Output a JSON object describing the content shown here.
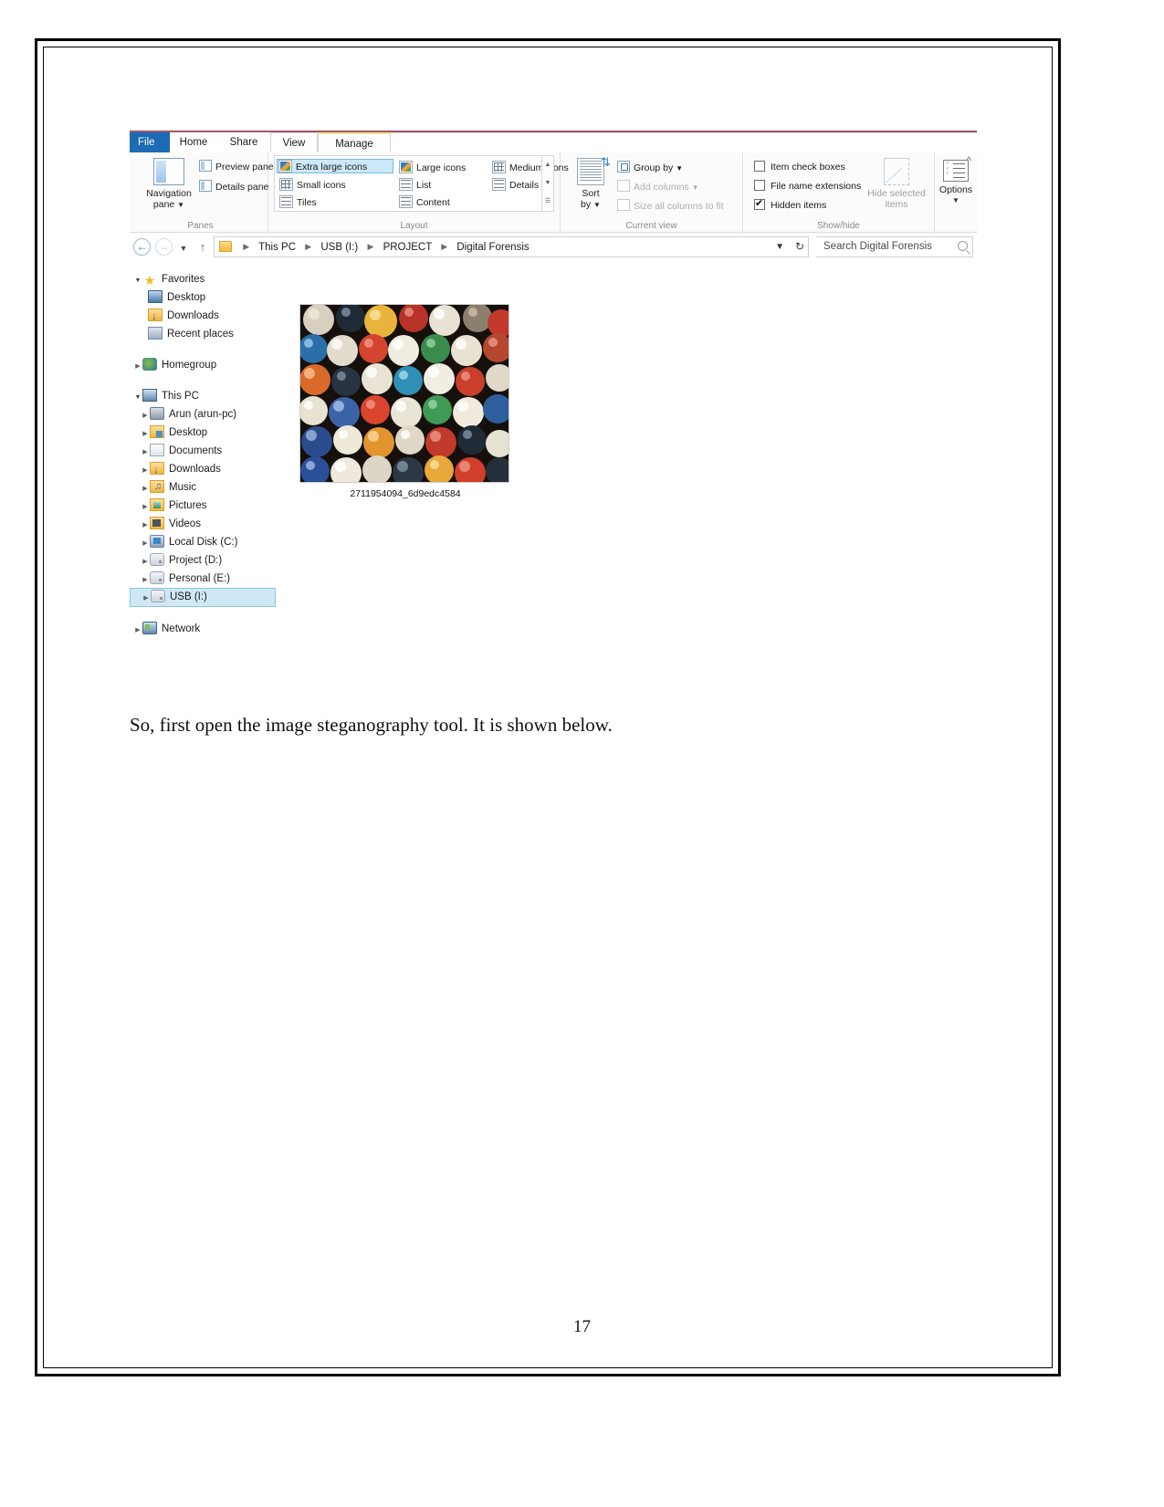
{
  "document": {
    "paragraph": "So, first open the image steganography tool. It is shown below.",
    "page_number": "17"
  },
  "explorer": {
    "tabs": [
      {
        "id": "file",
        "label": "File"
      },
      {
        "id": "home",
        "label": "Home"
      },
      {
        "id": "share",
        "label": "Share"
      },
      {
        "id": "view",
        "label": "View"
      },
      {
        "id": "manage",
        "label": "Manage"
      }
    ],
    "ribbon": {
      "collapse_icon": "chevron-up-icon",
      "groups": {
        "panes": {
          "label": "Panes",
          "navigation_pane": "Navigation\npane",
          "navigation_pane_line1": "Navigation",
          "navigation_pane_line2": "pane",
          "preview_pane": "Preview pane",
          "details_pane": "Details pane"
        },
        "layout": {
          "label": "Layout",
          "items": [
            "Extra large icons",
            "Large icons",
            "Medium icons",
            "Small icons",
            "List",
            "Details",
            "Tiles",
            "Content"
          ],
          "selected": "Extra large icons"
        },
        "current_view": {
          "label": "Current view",
          "sort_by_line1": "Sort",
          "sort_by_line2": "by",
          "group_by": "Group by",
          "add_columns": "Add columns",
          "size_all_columns": "Size all columns to fit"
        },
        "show_hide": {
          "label": "Show/hide",
          "item_check_boxes": {
            "label": "Item check boxes",
            "checked": false
          },
          "file_name_extensions": {
            "label": "File name extensions",
            "checked": false
          },
          "hidden_items": {
            "label": "Hidden items",
            "checked": true
          },
          "hide_selected_line1": "Hide selected",
          "hide_selected_line2": "items"
        },
        "options": {
          "label": "Options"
        }
      }
    },
    "address_bar": {
      "back_icon": "back-arrow-icon",
      "forward_icon": "forward-arrow-icon",
      "recent_icon": "chevron-down-icon",
      "up_icon": "up-arrow-icon",
      "breadcrumbs": [
        "This PC",
        "USB (I:)",
        "PROJECT",
        "Digital Forensis"
      ],
      "dropdown_icon": "chevron-down-icon",
      "refresh_icon": "refresh-icon",
      "search_placeholder": "Search Digital Forensis",
      "search_value": "Search Digital Forensis"
    },
    "nav_tree": [
      {
        "label": "Favorites",
        "level": 0,
        "twisty": "open",
        "icon": "star-icon"
      },
      {
        "label": "Desktop",
        "level": 1,
        "twisty": "none",
        "icon": "monitor-icon"
      },
      {
        "label": "Downloads",
        "level": 1,
        "twisty": "none",
        "icon": "downloads-folder-icon"
      },
      {
        "label": "Recent places",
        "level": 1,
        "twisty": "none",
        "icon": "recent-places-icon"
      },
      {
        "label": "Homegroup",
        "level": 0,
        "twisty": "closed",
        "icon": "homegroup-icon"
      },
      {
        "label": "This PC",
        "level": 0,
        "twisty": "open",
        "icon": "this-pc-icon"
      },
      {
        "label": "Arun (arun-pc)",
        "level": 1,
        "twisty": "closed",
        "icon": "user-icon"
      },
      {
        "label": "Desktop",
        "level": 1,
        "twisty": "closed",
        "icon": "desktop-folder-icon"
      },
      {
        "label": "Documents",
        "level": 1,
        "twisty": "closed",
        "icon": "documents-folder-icon"
      },
      {
        "label": "Downloads",
        "level": 1,
        "twisty": "closed",
        "icon": "downloads-folder-icon"
      },
      {
        "label": "Music",
        "level": 1,
        "twisty": "closed",
        "icon": "music-folder-icon"
      },
      {
        "label": "Pictures",
        "level": 1,
        "twisty": "closed",
        "icon": "pictures-folder-icon"
      },
      {
        "label": "Videos",
        "level": 1,
        "twisty": "closed",
        "icon": "videos-folder-icon"
      },
      {
        "label": "Local Disk (C:)",
        "level": 1,
        "twisty": "closed",
        "icon": "local-disk-icon"
      },
      {
        "label": "Project (D:)",
        "level": 1,
        "twisty": "closed",
        "icon": "drive-icon"
      },
      {
        "label": "Personal (E:)",
        "level": 1,
        "twisty": "closed",
        "icon": "drive-icon"
      },
      {
        "label": "USB (I:)",
        "level": 1,
        "twisty": "closed",
        "icon": "drive-icon",
        "selected": true
      },
      {
        "label": "Network",
        "level": 0,
        "twisty": "closed",
        "icon": "network-icon"
      }
    ],
    "file_item": {
      "name": "2711954094_6d9edc4584",
      "thumbnail": "marbles-photo"
    }
  },
  "colors": {
    "tab_file_blue": "#1d6ab5",
    "ribbon_accent": "#a6536b",
    "selection_blue": "#cfe8f6",
    "selection_border": "#8cc4e0",
    "manage_tab_accent": "#f2e48a"
  }
}
